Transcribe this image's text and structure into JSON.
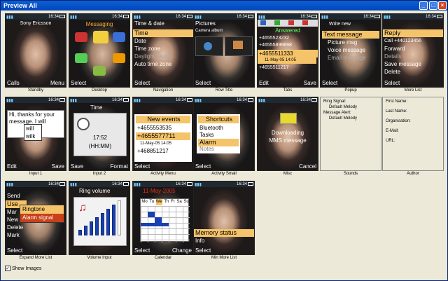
{
  "window": {
    "title": "Preview All"
  },
  "tiles": [
    {
      "caption": "Standby",
      "left": "Calls",
      "right": "Menu",
      "top": "Sony Ericsson",
      "time": "16:34"
    },
    {
      "caption": "Desktop",
      "left": "Select",
      "right": "",
      "top": "Messaging",
      "time": "16:34"
    },
    {
      "caption": "Navigation",
      "left": "Select",
      "right": "",
      "top": "Time & date",
      "time": "16:34",
      "items": [
        "Time",
        "Date",
        "Time zone",
        "Daylight saving",
        "Auto time zone"
      ]
    },
    {
      "caption": "Row Title",
      "left": "Select",
      "right": "",
      "top": "Pictures",
      "sub": "Camera album",
      "time": "16:34"
    },
    {
      "caption": "Tabs",
      "left": "Edit",
      "right": "Save",
      "top": "Answered",
      "time": "16:34",
      "items": [
        "+4655523232",
        "+46555899898",
        "+4655511333",
        "11-May-05   14:05",
        "+4655511217"
      ]
    },
    {
      "caption": "Popup",
      "left": "Select",
      "right": "",
      "top": "Write new",
      "time": "16:34",
      "items": [
        "Text message",
        "Picture msg",
        "Voice message",
        "Email message"
      ]
    },
    {
      "caption": "More List",
      "left": "Select",
      "right": "",
      "top": "Reply",
      "time": "16:34",
      "items": [
        "Call +440123456",
        "Forward",
        "Details",
        "Save message",
        "Delete"
      ]
    },
    {
      "caption": "Input 1",
      "left": "Edit",
      "right": "Save",
      "top": "",
      "time": "16:34",
      "text": "Hi, thanks for your message. I will",
      "menu": [
        "will",
        "wilk"
      ]
    },
    {
      "caption": "Input 2",
      "left": "Save",
      "right": "Format",
      "top": "Time",
      "time": "16:34",
      "clock": "17:52",
      "fmt": "(HH:MM)"
    },
    {
      "caption": "Activity Menu",
      "left": "Select",
      "right": "",
      "top": "New events",
      "time": "16:34",
      "items": [
        "+4655553535",
        "+4655577711",
        "11-May-05   14:05",
        "+468851217"
      ]
    },
    {
      "caption": "Activity Small",
      "left": "Select",
      "right": "",
      "top": "Shortcuts",
      "time": "16:34",
      "items": [
        "Bluetooth",
        "Tasks",
        "Alarm",
        "Notes"
      ]
    },
    {
      "caption": "Misc",
      "left": "",
      "right": "Cancel",
      "top": "",
      "time": "16:34",
      "msg1": "Downloading",
      "msg2": "MMS message"
    },
    {
      "caption": "Sounds",
      "lines": [
        "Ring Signal:",
        "Default Melody",
        "Message Alert:",
        "Default Melody"
      ]
    },
    {
      "caption": "Author",
      "lines": [
        "First Name:",
        "Last Name:",
        "Organisation:",
        "E-Mail:",
        "URL:"
      ]
    },
    {
      "caption": "Expand More List",
      "left": "Select",
      "right": "",
      "top": "",
      "time": "16:34",
      "items": [
        "Send",
        "Use",
        "Mar",
        "New",
        "Delete",
        "Mark"
      ],
      "popup": [
        "Ringtone",
        "Alarm signal"
      ]
    },
    {
      "caption": "Volume Input",
      "left": "",
      "right": "",
      "top": "Ring volume",
      "time": "16:34"
    },
    {
      "caption": "Calendar",
      "left": "Select",
      "right": "Change",
      "top": "11-May-2005",
      "time": "16:34",
      "days": [
        "Mo",
        "Tu",
        "We",
        "Th",
        "Fr",
        "Sa",
        "Su"
      ]
    },
    {
      "caption": "Min More List",
      "left": "Select",
      "right": "",
      "top": "",
      "time": "16:34",
      "items": [
        "Memory status",
        "Info"
      ]
    }
  ],
  "show_images_label": "Show Images",
  "show_images_checked": true
}
